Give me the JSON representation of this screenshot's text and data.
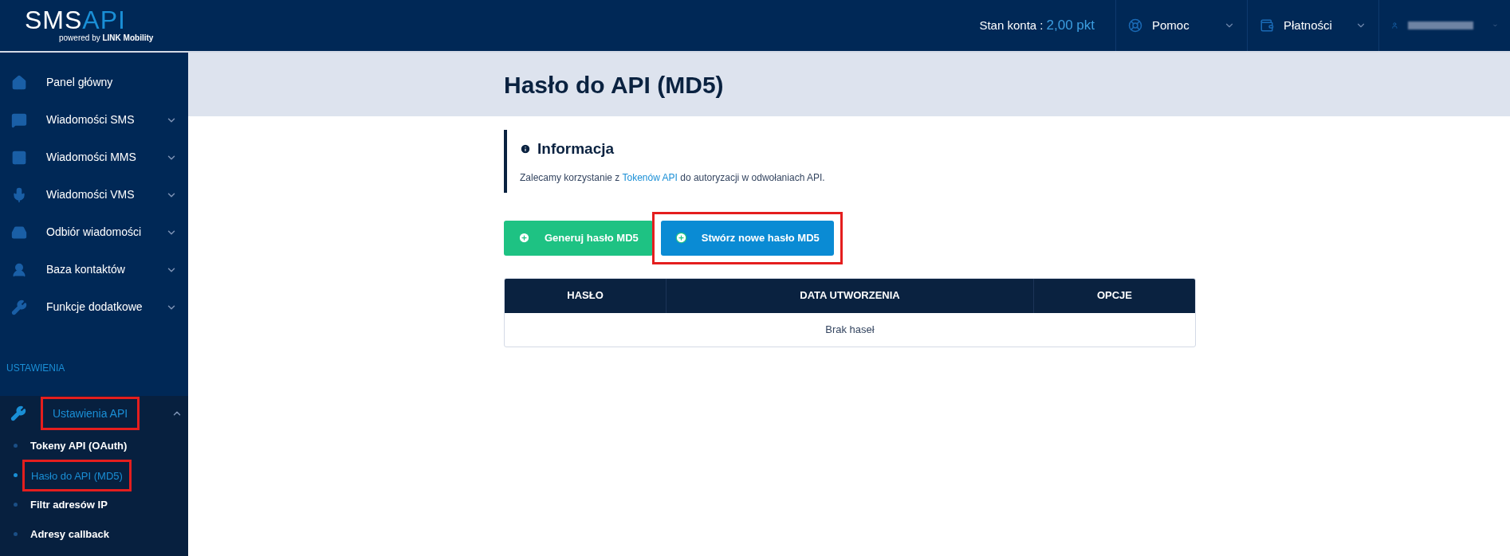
{
  "logo": {
    "brand_a": "SMS",
    "brand_b": "API",
    "tagline": "powered by",
    "tagline_brand": "LINK Mobility"
  },
  "topbar": {
    "balance_label": "Stan konta :",
    "balance_value": "2,00 pkt",
    "menus": [
      {
        "kind": "help",
        "label": "Pomoc"
      },
      {
        "kind": "payments",
        "label": "Płatności"
      },
      {
        "kind": "account"
      }
    ]
  },
  "sidebar": {
    "items": [
      {
        "label": "Panel główny",
        "expandable": false
      },
      {
        "label": "Wiadomości SMS",
        "expandable": true
      },
      {
        "label": "Wiadomości MMS",
        "expandable": true
      },
      {
        "label": "Wiadomości VMS",
        "expandable": true
      },
      {
        "label": "Odbiór wiadomości",
        "expandable": true
      },
      {
        "label": "Baza kontaktów",
        "expandable": true
      },
      {
        "label": "Funkcje dodatkowe",
        "expandable": true
      }
    ],
    "section_label": "USTAWIENIA",
    "section_item": {
      "label": "Ustawienia API",
      "expanded": true,
      "highlighted": true,
      "children": [
        {
          "label": "Tokeny API (OAuth)",
          "selected": false,
          "highlighted": false
        },
        {
          "label": "Hasło do API (MD5)",
          "selected": true,
          "highlighted": true
        },
        {
          "label": "Filtr adresów IP",
          "selected": false,
          "highlighted": false
        },
        {
          "label": "Adresy callback",
          "selected": false,
          "highlighted": false
        }
      ]
    }
  },
  "page": {
    "title": "Hasło do API (MD5)",
    "info": {
      "title": "Informacja",
      "text_before": "Zalecamy korzystanie z",
      "link": "Tokenów API",
      "text_after": "do autoryzacji w odwołaniach API."
    },
    "buttons": [
      {
        "kind": "green",
        "label": "Generuj hasło MD5",
        "highlighted": false
      },
      {
        "kind": "blue",
        "label": "Stwórz nowe hasło MD5",
        "highlighted": true
      }
    ],
    "table": {
      "columns": [
        "HASŁO",
        "DATA UTWORZENIA",
        "OPCJE"
      ],
      "empty_text": "Brak haseł"
    }
  }
}
